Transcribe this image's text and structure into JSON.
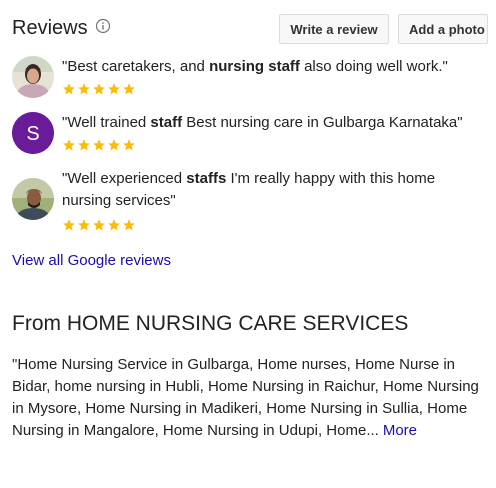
{
  "header": {
    "title": "Reviews",
    "write_review_label": "Write a review",
    "add_photo_label": "Add a photo"
  },
  "reviews": [
    {
      "pre": "\"Best caretakers, and ",
      "bold1": "nursing staff",
      "post": " also doing well work.\"",
      "rating": 5,
      "avatar": "photo-woman"
    },
    {
      "pre": "\"Well trained ",
      "bold1": "staff",
      "post": " Best nursing care in Gulbarga Karnataka\"",
      "rating": 5,
      "avatar_letter": "S",
      "avatar_color": "#6a1b9a"
    },
    {
      "pre": "\"Well experienced ",
      "bold1": "staffs",
      "post": " I'm really happy with this home nursing services\"",
      "rating": 5,
      "avatar": "photo-man"
    }
  ],
  "view_all_label": "View all Google reviews",
  "from": {
    "title": "From HOME NURSING CARE SERVICES",
    "description": "\"Home Nursing Service in Gulbarga, Home nurses, Home Nurse in Bidar, home nursing in Hubli, Home Nursing in Raichur, Home Nursing in Mysore, Home Nursing in Madikeri, Home Nursing in Sullia, Home Nursing in Mangalore, Home Nursing in Udupi, Home...",
    "more_label": "More"
  },
  "colors": {
    "star": "#fbbc04",
    "link": "#1a0dab"
  }
}
